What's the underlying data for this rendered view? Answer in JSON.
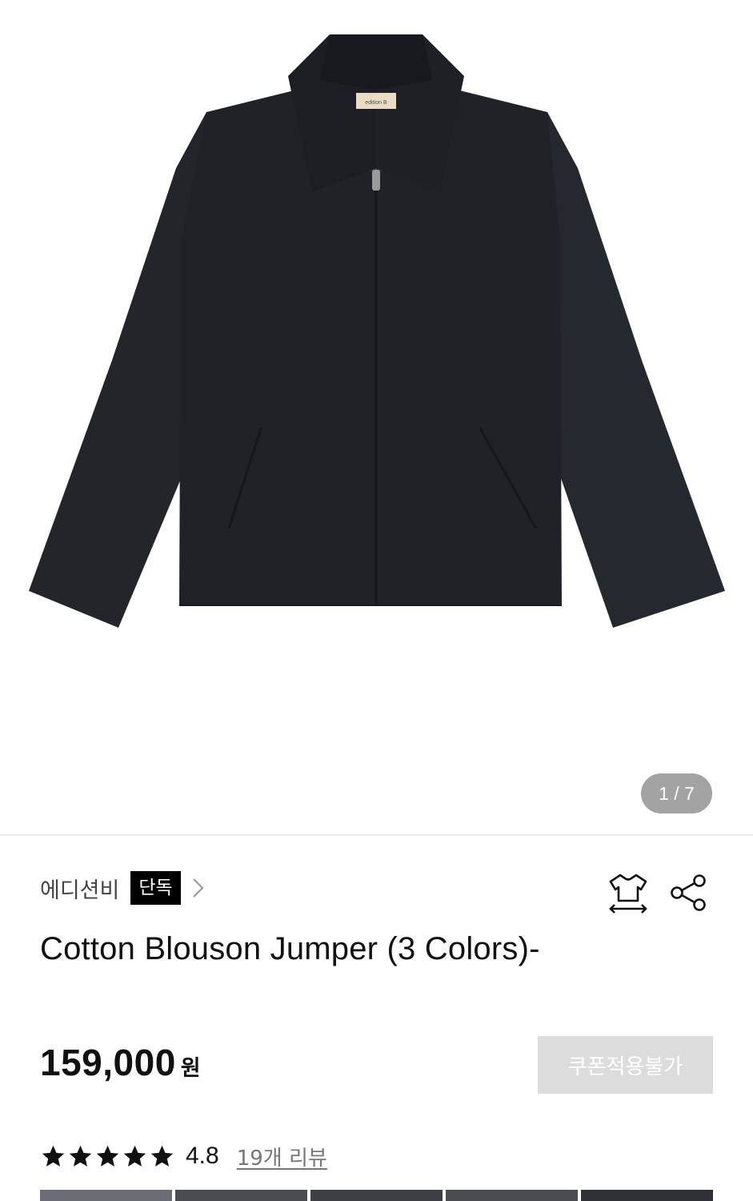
{
  "gallery": {
    "counter_text": "1 / 7",
    "image_icon": "product-photo-black-jacket",
    "label_text": "edition B"
  },
  "brand": {
    "name": "에디션비",
    "badge": "단독",
    "chevron_icon": "chevron-right-icon"
  },
  "actions": {
    "size_icon": "tshirt-size-icon",
    "share_icon": "share-icon"
  },
  "product": {
    "title": "Cotton Blouson Jumper (3 Colors)-",
    "price": "159,000",
    "currency": "원",
    "coupon_label": "쿠폰적용불가"
  },
  "rating": {
    "stars": 5,
    "value": "4.8",
    "review_link": "19개 리뷰"
  },
  "colors": {
    "badge_bg": "#000000",
    "coupon_bg": "#dcdcdc",
    "counter_bg": "#a3a3a3",
    "jacket": "#23252b"
  }
}
